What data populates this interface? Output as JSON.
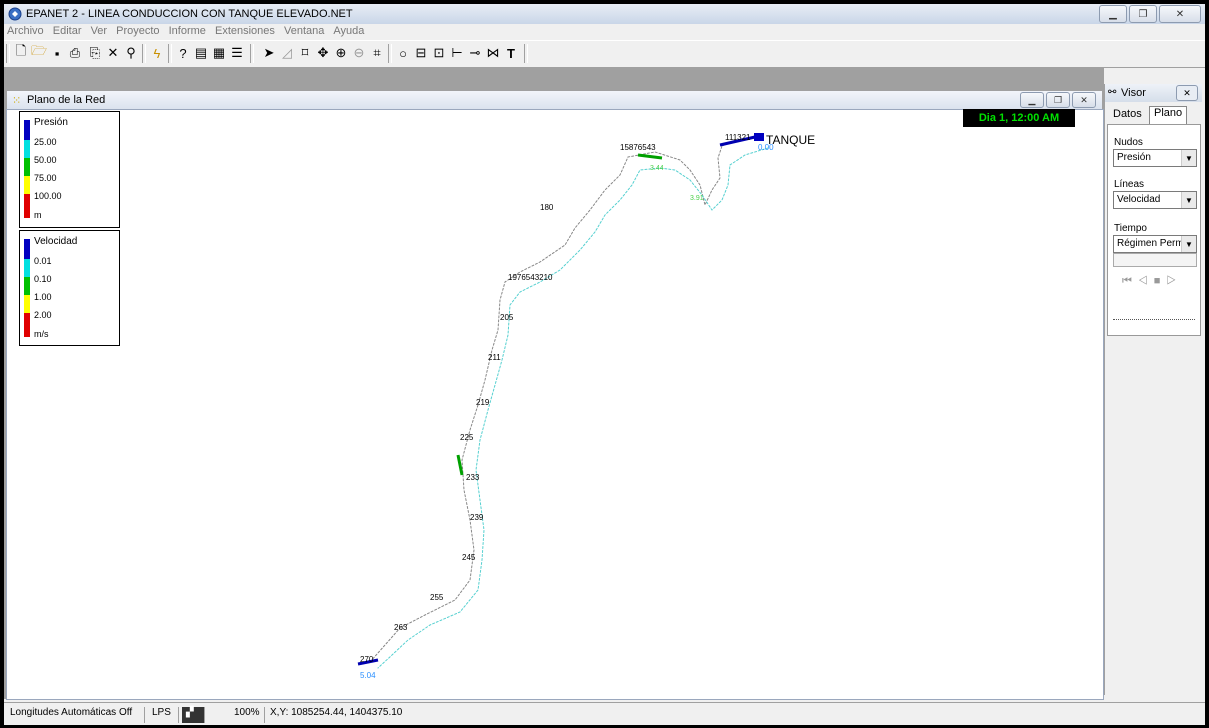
{
  "window": {
    "title": "EPANET 2 - LINEA CONDUCCION CON TANQUE ELEVADO.NET"
  },
  "menu": [
    "Archivo",
    "Editar",
    "Ver",
    "Proyecto",
    "Informe",
    "Extensiones",
    "Ventana",
    "Ayuda"
  ],
  "network_window": {
    "title": "Plano de la Red"
  },
  "legend_pressure": {
    "title": "Presión",
    "values": [
      "25.00",
      "50.00",
      "75.00",
      "100.00"
    ],
    "unit": "m",
    "colors": [
      "#0000c0",
      "#00e0e0",
      "#00c000",
      "#ffff00",
      "#e00000"
    ]
  },
  "legend_velocity": {
    "title": "Velocidad",
    "values": [
      "0.01",
      "0.10",
      "1.00",
      "2.00"
    ],
    "unit": "m/s",
    "colors": [
      "#0000c0",
      "#00e0e0",
      "#00c000",
      "#ffff00",
      "#e00000"
    ]
  },
  "time_display": "Dia 1, 12:00 AM",
  "map": {
    "tank_label": "TANQUE",
    "tank_flow": "0.00",
    "start_node": "270",
    "start_flow": "5.04"
  },
  "visor": {
    "title": "Visor",
    "tabs": [
      "Datos",
      "Plano"
    ],
    "nodos_label": "Nudos",
    "nodos_value": "Presión",
    "lineas_label": "Líneas",
    "lineas_value": "Velocidad",
    "tiempo_label": "Tiempo",
    "tiempo_value": "Régimen Perma"
  },
  "status": {
    "auto_length": "Longitudes Automáticas Off",
    "units": "LPS",
    "zoom": "100%",
    "xy": "X,Y: 1085254.44, 1404375.10"
  }
}
